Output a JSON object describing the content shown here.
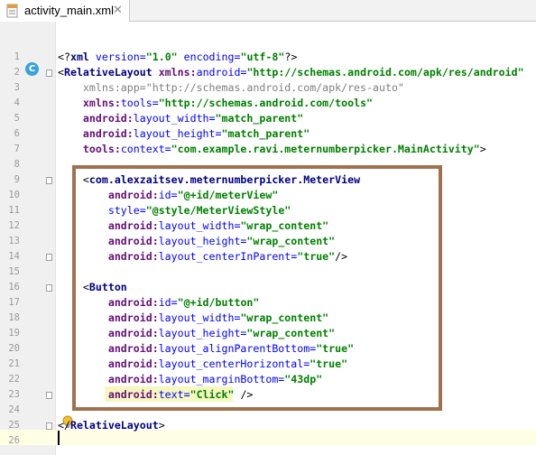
{
  "tab": {
    "label": "activity_main.xml",
    "close": "✕"
  },
  "gutter_marker": "C",
  "lines": [
    {
      "n": "1",
      "parts": [
        [
          "plain",
          "<?"
        ],
        [
          "tag",
          "xml"
        ],
        [
          "attr",
          " version="
        ],
        [
          "val",
          "\"1.0\""
        ],
        [
          "attr",
          " encoding="
        ],
        [
          "val",
          "\"utf-8\""
        ],
        [
          "plain",
          "?>"
        ]
      ]
    },
    {
      "n": "2",
      "parts": [
        [
          "plain",
          "<"
        ],
        [
          "tag",
          "RelativeLayout"
        ],
        [
          "ns",
          " xmlns:"
        ],
        [
          "attr",
          "android="
        ],
        [
          "val",
          "\"http://schemas.android.com/apk/res/android\""
        ]
      ]
    },
    {
      "n": "3",
      "parts": [
        [
          "gray",
          "    xmlns:app=\"http://schemas.android.com/apk/res-auto\""
        ]
      ]
    },
    {
      "n": "4",
      "parts": [
        [
          "ns",
          "    xmlns:"
        ],
        [
          "attr",
          "tools="
        ],
        [
          "val",
          "\"http://schemas.android.com/tools\""
        ]
      ]
    },
    {
      "n": "5",
      "parts": [
        [
          "ns",
          "    android:"
        ],
        [
          "attr",
          "layout_width="
        ],
        [
          "val",
          "\"match_parent\""
        ]
      ]
    },
    {
      "n": "6",
      "parts": [
        [
          "ns",
          "    android:"
        ],
        [
          "attr",
          "layout_height="
        ],
        [
          "val",
          "\"match_parent\""
        ]
      ]
    },
    {
      "n": "7",
      "parts": [
        [
          "ns",
          "    tools:"
        ],
        [
          "attr",
          "context="
        ],
        [
          "val",
          "\"com.example.ravi.meternumberpicker.MainActivity\""
        ],
        [
          "plain",
          ">"
        ]
      ]
    },
    {
      "n": "8",
      "parts": []
    },
    {
      "n": "9",
      "parts": [
        [
          "plain",
          "    <"
        ],
        [
          "tag",
          "com.alexzaitsev.meternumberpicker.MeterView"
        ]
      ]
    },
    {
      "n": "10",
      "parts": [
        [
          "ns",
          "        android:"
        ],
        [
          "attr",
          "id="
        ],
        [
          "val",
          "\"@+id/meterView\""
        ]
      ]
    },
    {
      "n": "11",
      "parts": [
        [
          "attr",
          "        style="
        ],
        [
          "val",
          "\"@style/MeterViewStyle\""
        ]
      ]
    },
    {
      "n": "12",
      "parts": [
        [
          "ns",
          "        android:"
        ],
        [
          "attr",
          "layout_width="
        ],
        [
          "val",
          "\"wrap_content\""
        ]
      ]
    },
    {
      "n": "13",
      "parts": [
        [
          "ns",
          "        android:"
        ],
        [
          "attr",
          "layout_height="
        ],
        [
          "val",
          "\"wrap_content\""
        ]
      ]
    },
    {
      "n": "14",
      "parts": [
        [
          "ns",
          "        android:"
        ],
        [
          "attr",
          "layout_centerInParent="
        ],
        [
          "val",
          "\"true\""
        ],
        [
          "plain",
          "/>"
        ]
      ]
    },
    {
      "n": "15",
      "parts": []
    },
    {
      "n": "16",
      "parts": [
        [
          "plain",
          "    <"
        ],
        [
          "tag",
          "Button"
        ]
      ]
    },
    {
      "n": "17",
      "parts": [
        [
          "ns",
          "        android:"
        ],
        [
          "attr",
          "id="
        ],
        [
          "val",
          "\"@+id/button\""
        ]
      ]
    },
    {
      "n": "18",
      "parts": [
        [
          "ns",
          "        android:"
        ],
        [
          "attr",
          "layout_width="
        ],
        [
          "val",
          "\"wrap_content\""
        ]
      ]
    },
    {
      "n": "19",
      "parts": [
        [
          "ns",
          "        android:"
        ],
        [
          "attr",
          "layout_height="
        ],
        [
          "val",
          "\"wrap_content\""
        ]
      ]
    },
    {
      "n": "20",
      "parts": [
        [
          "ns",
          "        android:"
        ],
        [
          "attr",
          "layout_alignParentBottom="
        ],
        [
          "val",
          "\"true\""
        ]
      ]
    },
    {
      "n": "21",
      "parts": [
        [
          "ns",
          "        android:"
        ],
        [
          "attr",
          "layout_centerHorizontal="
        ],
        [
          "val",
          "\"true\""
        ]
      ]
    },
    {
      "n": "22",
      "parts": [
        [
          "ns",
          "        android:"
        ],
        [
          "attr",
          "layout_marginBottom="
        ],
        [
          "val",
          "\"43dp\""
        ]
      ]
    },
    {
      "n": "23",
      "parts": [
        [
          "ns",
          "        android:"
        ],
        [
          "attr",
          "text="
        ],
        [
          "val",
          "\"Click\""
        ],
        [
          "plain",
          " />"
        ]
      ]
    },
    {
      "n": "24",
      "parts": []
    },
    {
      "n": "25",
      "parts": [
        [
          "plain",
          "</"
        ],
        [
          "tag",
          "RelativeLayout"
        ],
        [
          "plain",
          ">"
        ]
      ]
    },
    {
      "n": "26",
      "parts": []
    }
  ],
  "colors": {
    "highlight_box": "#a0714f",
    "current_line": "#ffffe4",
    "marker": "#3aa3d8"
  }
}
